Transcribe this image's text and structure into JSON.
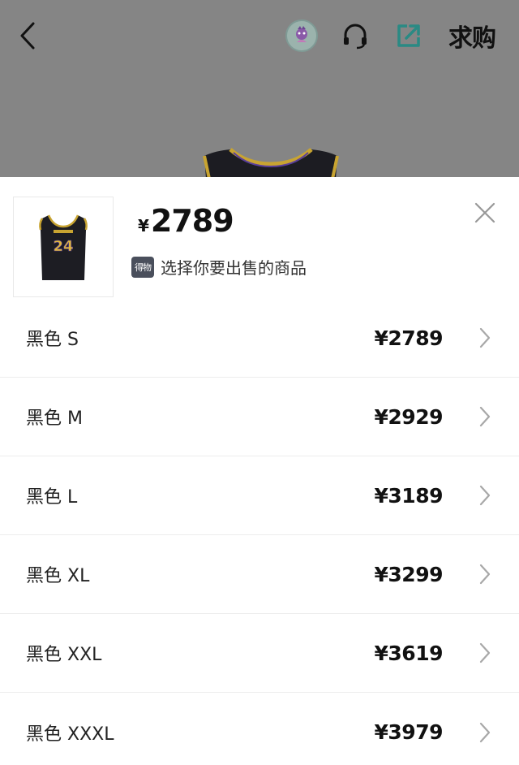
{
  "nav": {
    "back_icon": "chevron-left-icon",
    "avatar_icon": "mascot-avatar-icon",
    "service_icon": "headset-icon",
    "share_icon": "share-external-icon",
    "seek_label": "求购"
  },
  "sheet": {
    "currency": "¥",
    "price": "2789",
    "hint_badge": "得物",
    "hint_text": "选择你要出售的商品",
    "close_icon": "close-icon",
    "jersey_number": "24"
  },
  "sizes": [
    {
      "label": "黑色 S",
      "price": "¥2789"
    },
    {
      "label": "黑色 M",
      "price": "¥2929"
    },
    {
      "label": "黑色 L",
      "price": "¥3189"
    },
    {
      "label": "黑色 XL",
      "price": "¥3299"
    },
    {
      "label": "黑色 XXL",
      "price": "¥3619"
    },
    {
      "label": "黑色 XXXL",
      "price": "¥3979"
    }
  ],
  "colors": {
    "backdrop": "#858585",
    "share_accent": "#2a8a84",
    "row_divider": "#ededed"
  }
}
